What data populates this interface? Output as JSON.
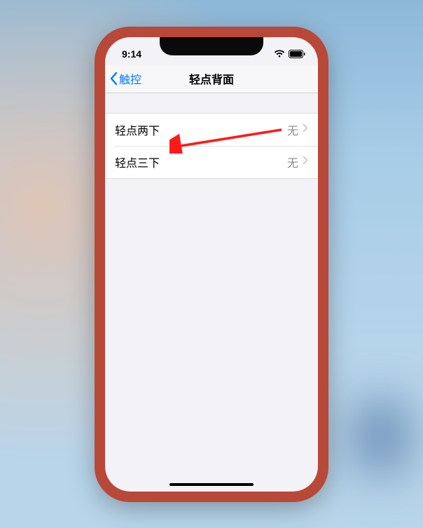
{
  "status": {
    "time": "9:14"
  },
  "nav": {
    "back_label": "触控",
    "title": "轻点背面"
  },
  "rows": [
    {
      "label": "轻点两下",
      "value": "无"
    },
    {
      "label": "轻点三下",
      "value": "无"
    }
  ]
}
